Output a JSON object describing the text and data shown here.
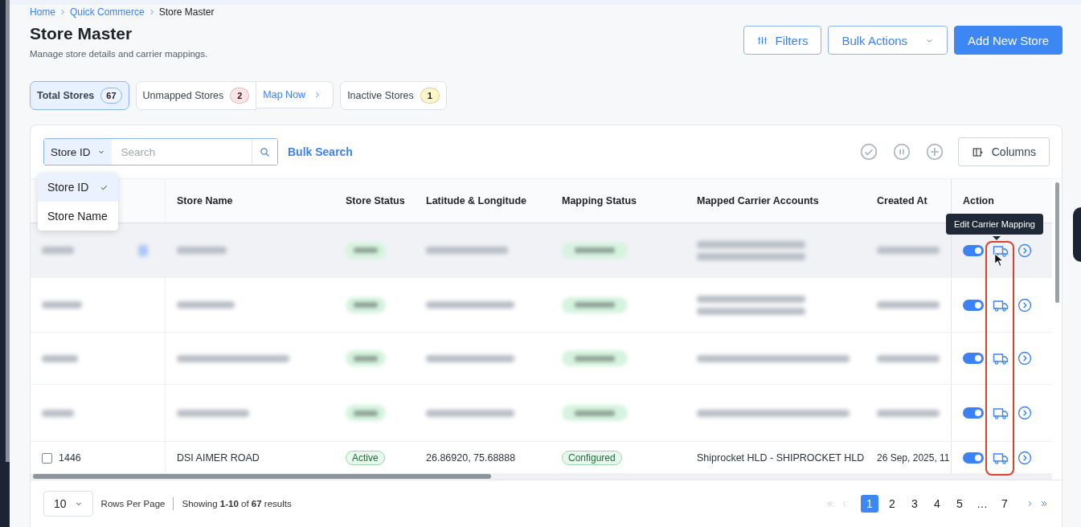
{
  "breadcrumb": [
    {
      "label": "Home",
      "kind": "link"
    },
    {
      "label": "Quick Commerce",
      "kind": "link"
    },
    {
      "label": "Store Master",
      "kind": "current"
    }
  ],
  "title": "Store Master",
  "subtitle": "Manage store details and carrier mappings.",
  "header_buttons": [
    {
      "label": "Filters",
      "kind": "filters"
    },
    {
      "label": "Bulk Actions",
      "kind": "dropdown"
    },
    {
      "label": "Add New Store",
      "kind": "primary"
    }
  ],
  "stat_chips": [
    {
      "label": "Total Stores",
      "count": "67",
      "selected": true,
      "color": "#eef4ff"
    },
    {
      "label": "Unmapped Stores",
      "count": "2",
      "selected": false,
      "color": "#fde3e3",
      "action": "Map Now"
    },
    {
      "label": "Inactive Stores",
      "count": "1",
      "selected": false,
      "color": "#fff5c9"
    }
  ],
  "search": {
    "field": "Store ID",
    "placeholder": "Search",
    "bulk_search": "Bulk Search"
  },
  "field_menu": [
    {
      "label": "Store ID",
      "selected": true
    },
    {
      "label": "Store Name",
      "selected": false
    }
  ],
  "bulk_icons": [
    {
      "kind": "check",
      "disabled": true
    },
    {
      "kind": "pause",
      "disabled": true
    },
    {
      "kind": "plus",
      "disabled": true
    }
  ],
  "columns_button": "Columns",
  "table": {
    "columns": [
      "Store Name",
      "Store Status",
      "Latitude & Longitude",
      "Mapping Status",
      "Mapped Carrier Accounts",
      "Created At",
      "Action"
    ],
    "rows": [
      {
        "kind": "redacted",
        "highlighted": true,
        "on": true
      },
      {
        "kind": "redacted",
        "highlighted": false,
        "on": true
      },
      {
        "kind": "redacted",
        "highlighted": false,
        "on": true
      },
      {
        "kind": "redacted",
        "highlighted": false,
        "on": true
      },
      {
        "kind": "plain",
        "highlighted": false,
        "on": true,
        "checked": false,
        "store_id": "1446",
        "store_name": "DSI AIMER ROAD",
        "store_status": "Active",
        "lat_long": "26.86920, 75.68888",
        "mapping_status": "Configured",
        "carrier_accounts": "Shiprocket HLD - SHIPROCKET HLD",
        "created_at": "26 Sep, 2025, 11"
      }
    ]
  },
  "tooltip": "Edit Carrier Mapping",
  "footer": {
    "rows_per_page": "10",
    "rows_label": "Rows Per Page",
    "showing": "Showing **1-10** of **67** results",
    "nav": [
      {
        "kind": "first",
        "disabled": true
      },
      {
        "kind": "prev",
        "disabled": true
      }
    ],
    "pages": [
      {
        "label": "1",
        "selected": true
      },
      {
        "label": "2",
        "selected": false
      },
      {
        "label": "3",
        "selected": false
      },
      {
        "label": "4",
        "selected": false
      },
      {
        "label": "5",
        "selected": false
      },
      {
        "label": "…",
        "selected": false
      },
      {
        "label": "7",
        "selected": false
      }
    ],
    "nav_end": [
      {
        "kind": "next",
        "disabled": false
      },
      {
        "kind": "last",
        "disabled": false
      }
    ]
  }
}
